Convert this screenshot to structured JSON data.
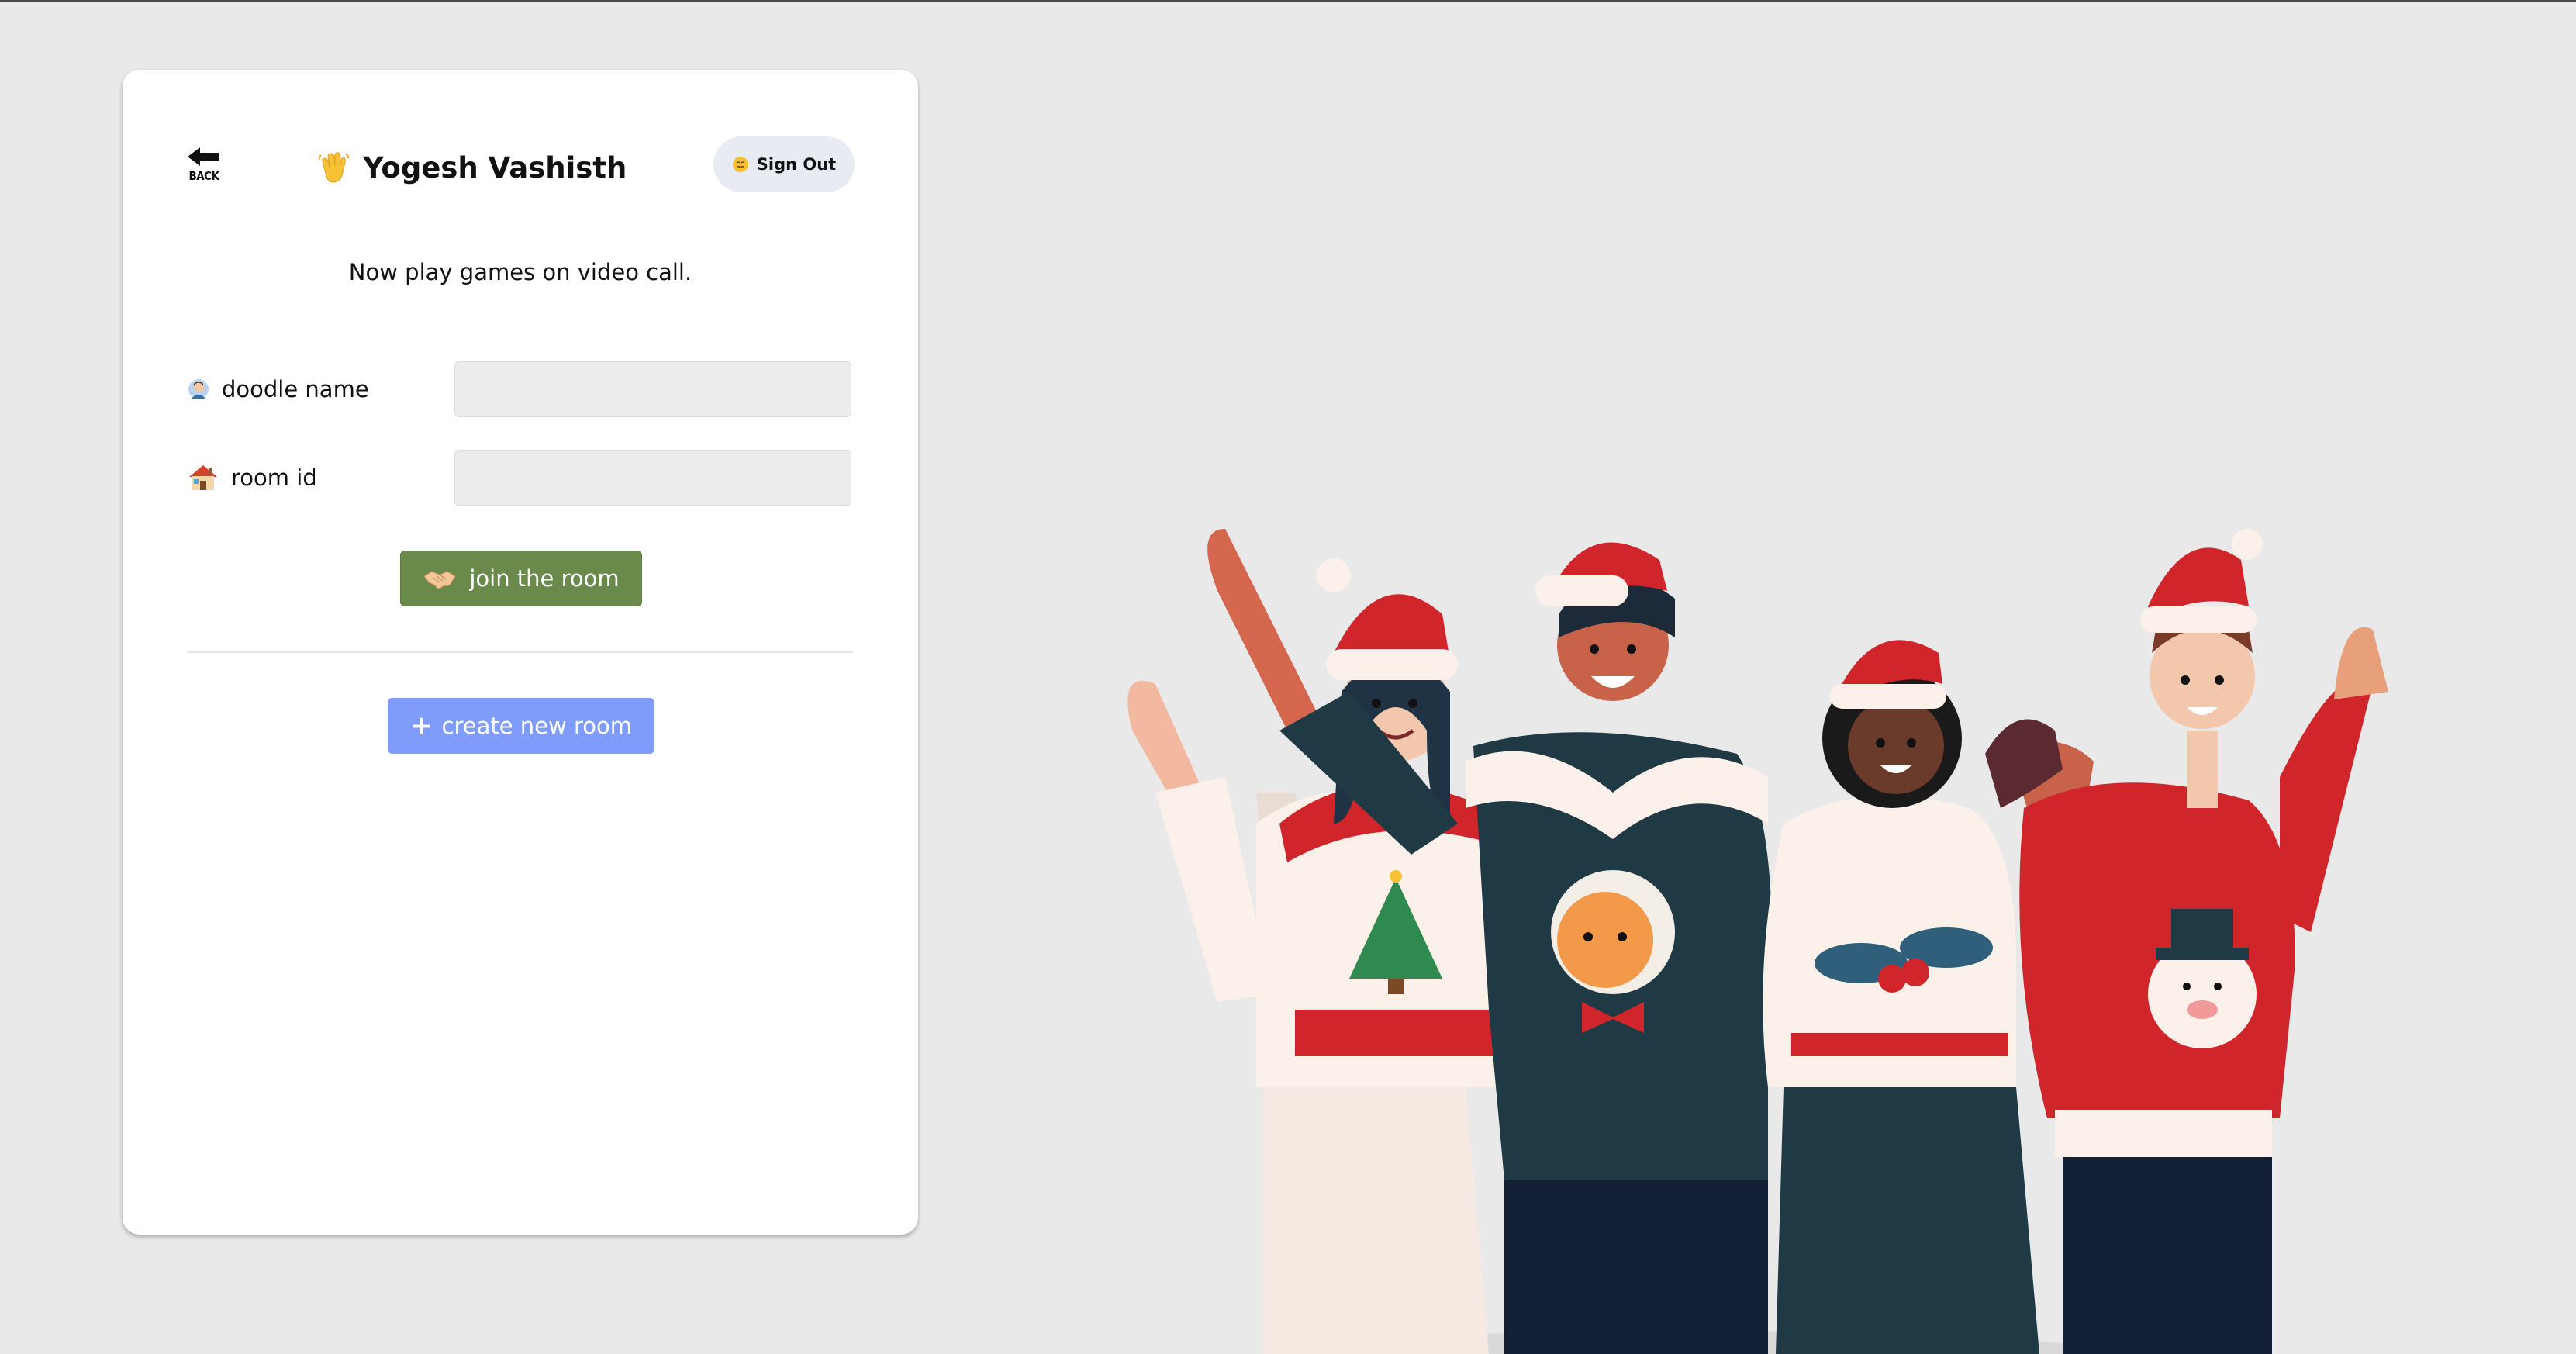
{
  "header": {
    "back_label": "BACK",
    "title": "Yogesh Vashisth",
    "title_icon": "waving-hand-icon",
    "sign_out_label": "Sign Out",
    "sign_out_icon": "face-emoji-icon"
  },
  "tagline": "Now play games on video call.",
  "form": {
    "doodle_name": {
      "label": "doodle name",
      "icon": "person-emoji-icon",
      "value": ""
    },
    "room_id": {
      "label": "room id",
      "icon": "house-emoji-icon",
      "value": ""
    }
  },
  "buttons": {
    "join_label": "join the room",
    "join_icon": "handshake-icon",
    "create_label": "create new room",
    "create_icon": "plus-icon"
  },
  "colors": {
    "background": "#e9e9e9",
    "card": "#ffffff",
    "join_button": "#6a8a4c",
    "create_button": "#7f9cfb",
    "sign_out_bg": "#e8ecf2"
  }
}
